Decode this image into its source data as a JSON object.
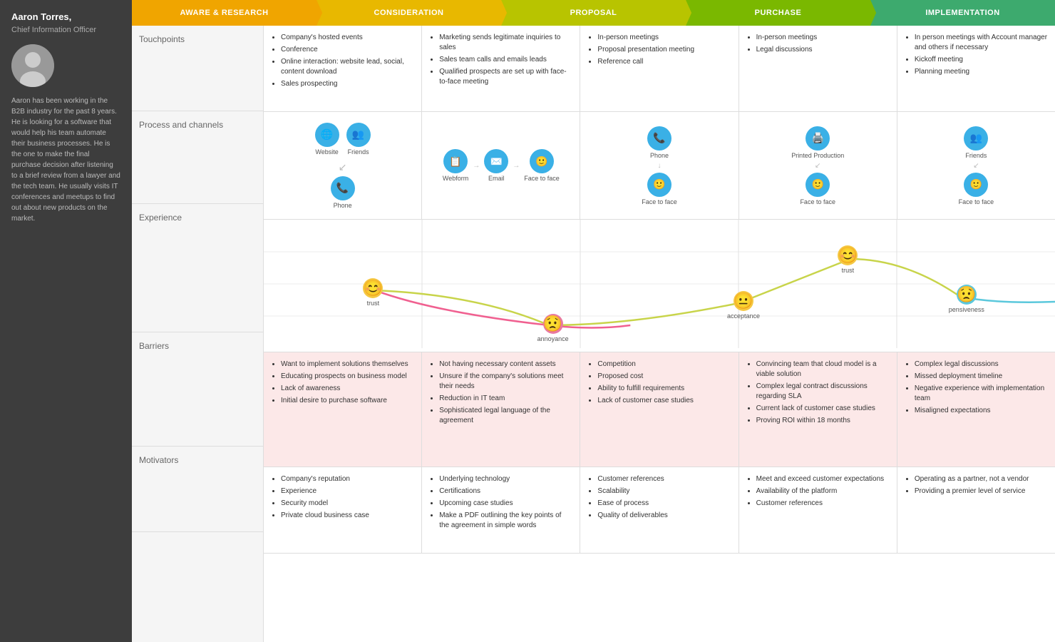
{
  "sidebar": {
    "name": "Aaron Torres,",
    "title": "Chief Information Officer",
    "bio": "Aaron has been working in the B2B industry for the past 8 years. He is looking for a software that would help his team automate their business processes. He is the one to make the final purchase decision after listening to a brief review from a lawyer and the tech team. He usually visits IT conferences and meetups to find out about new products on the market."
  },
  "stages": [
    {
      "id": "aware",
      "label": "Aware & Research",
      "class": "stage-aware"
    },
    {
      "id": "consideration",
      "label": "Consideration",
      "class": "stage-consideration"
    },
    {
      "id": "proposal",
      "label": "Proposal",
      "class": "stage-proposal"
    },
    {
      "id": "purchase",
      "label": "Purchase",
      "class": "stage-purchase"
    },
    {
      "id": "implementation",
      "label": "Implementation",
      "class": "stage-implementation"
    }
  ],
  "rows": {
    "touchpoints": {
      "label": "Touchpoints",
      "cells": [
        [
          "Company's hosted events",
          "Conference",
          "Online interaction: website lead, social, content download",
          "Sales prospecting"
        ],
        [
          "Marketing sends legitimate inquiries to sales",
          "Sales team calls and emails leads",
          "Qualified prospects are set up with face-to-face meeting"
        ],
        [
          "In-person meetings",
          "Proposal presentation meeting",
          "Reference call"
        ],
        [
          "In-person meetings",
          "Legal discussions"
        ],
        [
          "In person meetings with Account manager and others if necessary",
          "Kickoff meeting",
          "Planning meeting"
        ]
      ]
    },
    "process": {
      "label": "Process and channels",
      "cells": [
        {
          "icons": [
            "Website",
            "Friends",
            "Phone"
          ],
          "flow": "two-col"
        },
        {
          "icons": [
            "Webform",
            "Email",
            "Face to face"
          ],
          "flow": "linear"
        },
        {
          "icons": [
            "Phone",
            "Face to face"
          ],
          "flow": "vertical"
        },
        {
          "icons": [
            "Printed Production",
            "Face to face"
          ],
          "flow": "vertical"
        },
        {
          "icons": [
            "Friends",
            "Face to face"
          ],
          "flow": "vertical"
        }
      ]
    },
    "experience": {
      "label": "Experience",
      "emotions": [
        {
          "x": 14,
          "y": 55,
          "label": "trust",
          "emoji": "😊",
          "color": "#f5c842"
        },
        {
          "x": 36,
          "y": 82,
          "label": "annoyance",
          "emoji": "😟",
          "color": "#e879a0"
        },
        {
          "x": 60,
          "y": 65,
          "label": "acceptance",
          "emoji": "😐",
          "color": "#f5c842"
        },
        {
          "x": 74,
          "y": 30,
          "label": "trust",
          "emoji": "😊",
          "color": "#f5c842"
        },
        {
          "x": 88,
          "y": 60,
          "label": "pensiveness",
          "emoji": "😟",
          "color": "#5bc8dc"
        }
      ]
    },
    "barriers": {
      "label": "Barriers",
      "cells": [
        [
          "Want to implement solutions themselves",
          "Educating prospects on business model",
          "Lack of awareness",
          "Initial desire to purchase software"
        ],
        [
          "Not having necessary content assets",
          "Unsure if the company's solutions meet their needs",
          "Reduction in IT team",
          "Sophisticated legal language of the agreement"
        ],
        [
          "Competition",
          "Proposed cost",
          "Ability to fulfill requirements",
          "Lack of customer case studies"
        ],
        [
          "Convincing team that cloud model is a viable solution",
          "Complex legal contract discussions regarding SLA",
          "Current lack of customer case studies",
          "Proving ROI within 18 months"
        ],
        [
          "Complex legal discussions",
          "Missed deployment timeline",
          "Negative experience with implementation team",
          "Misaligned expectations"
        ]
      ]
    },
    "motivators": {
      "label": "Motivators",
      "cells": [
        [
          "Company's reputation",
          "Experience",
          "Security model",
          "Private cloud business case"
        ],
        [
          "Underlying technology",
          "Certifications",
          "Upcoming case studies",
          "Make a PDF outlining the key points of the agreement in simple words"
        ],
        [
          "Customer references",
          "Scalability",
          "Ease of process",
          "Quality of deliverables"
        ],
        [
          "Meet and exceed customer expectations",
          "Availability of the platform",
          "Customer references"
        ],
        [
          "Operating as a partner, not a vendor",
          "Providing a premier level of service"
        ]
      ]
    }
  }
}
